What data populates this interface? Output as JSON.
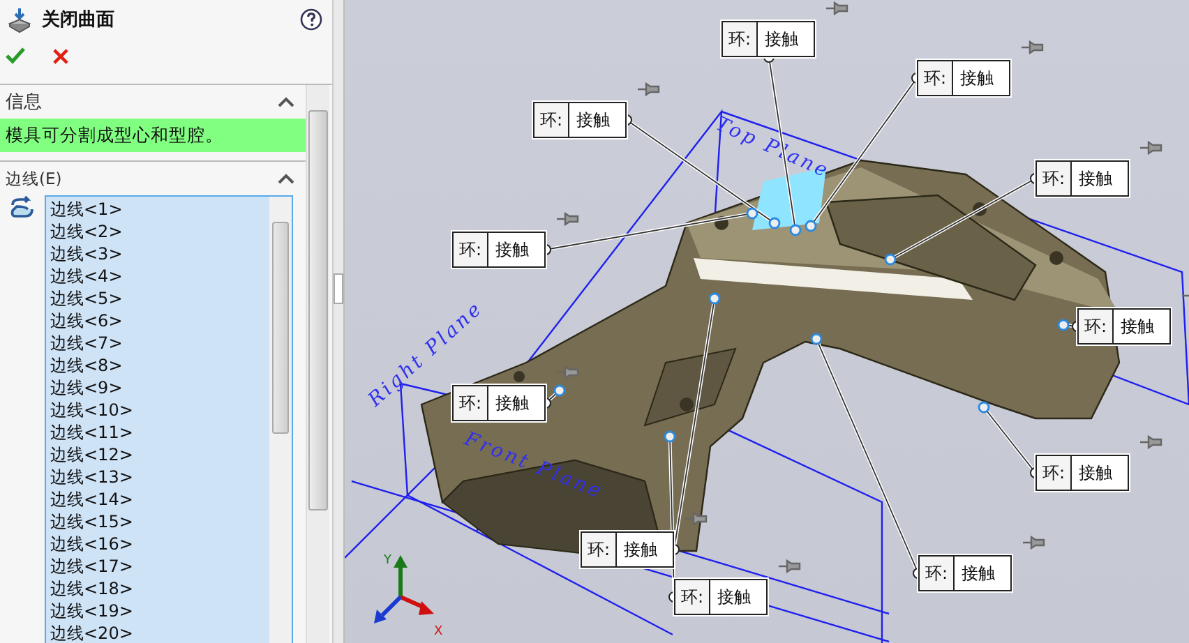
{
  "panel": {
    "title": "关闭曲面",
    "info": {
      "heading": "信息",
      "expanded": true,
      "message": "模具可分割成型心和型腔。"
    },
    "edges": {
      "heading": "边线(E)",
      "expanded": true,
      "items": [
        "边线<1>",
        "边线<2>",
        "边线<3>",
        "边线<4>",
        "边线<5>",
        "边线<6>",
        "边线<7>",
        "边线<8>",
        "边线<9>",
        "边线<10>",
        "边线<11>",
        "边线<12>",
        "边线<13>",
        "边线<14>",
        "边线<15>",
        "边线<16>",
        "边线<17>",
        "边线<18>",
        "边线<19>",
        "边线<20>"
      ]
    }
  },
  "viewport": {
    "plane_labels": [
      "Top Plane",
      "Front Plane",
      "Right Plane"
    ],
    "callouts": [
      {
        "label": "环:",
        "value": "接触"
      },
      {
        "label": "环:",
        "value": "接触"
      },
      {
        "label": "环:",
        "value": "接触"
      },
      {
        "label": "环:",
        "value": "接触"
      },
      {
        "label": "环:",
        "value": "接触"
      },
      {
        "label": "环:",
        "value": "接触"
      },
      {
        "label": "环:",
        "value": "接触"
      },
      {
        "label": "环:",
        "value": "接触"
      },
      {
        "label": "环:",
        "value": "接触"
      },
      {
        "label": "环:",
        "value": "接触"
      },
      {
        "label": "环:",
        "value": "接触"
      }
    ],
    "triad": [
      "Y",
      "X"
    ]
  }
}
